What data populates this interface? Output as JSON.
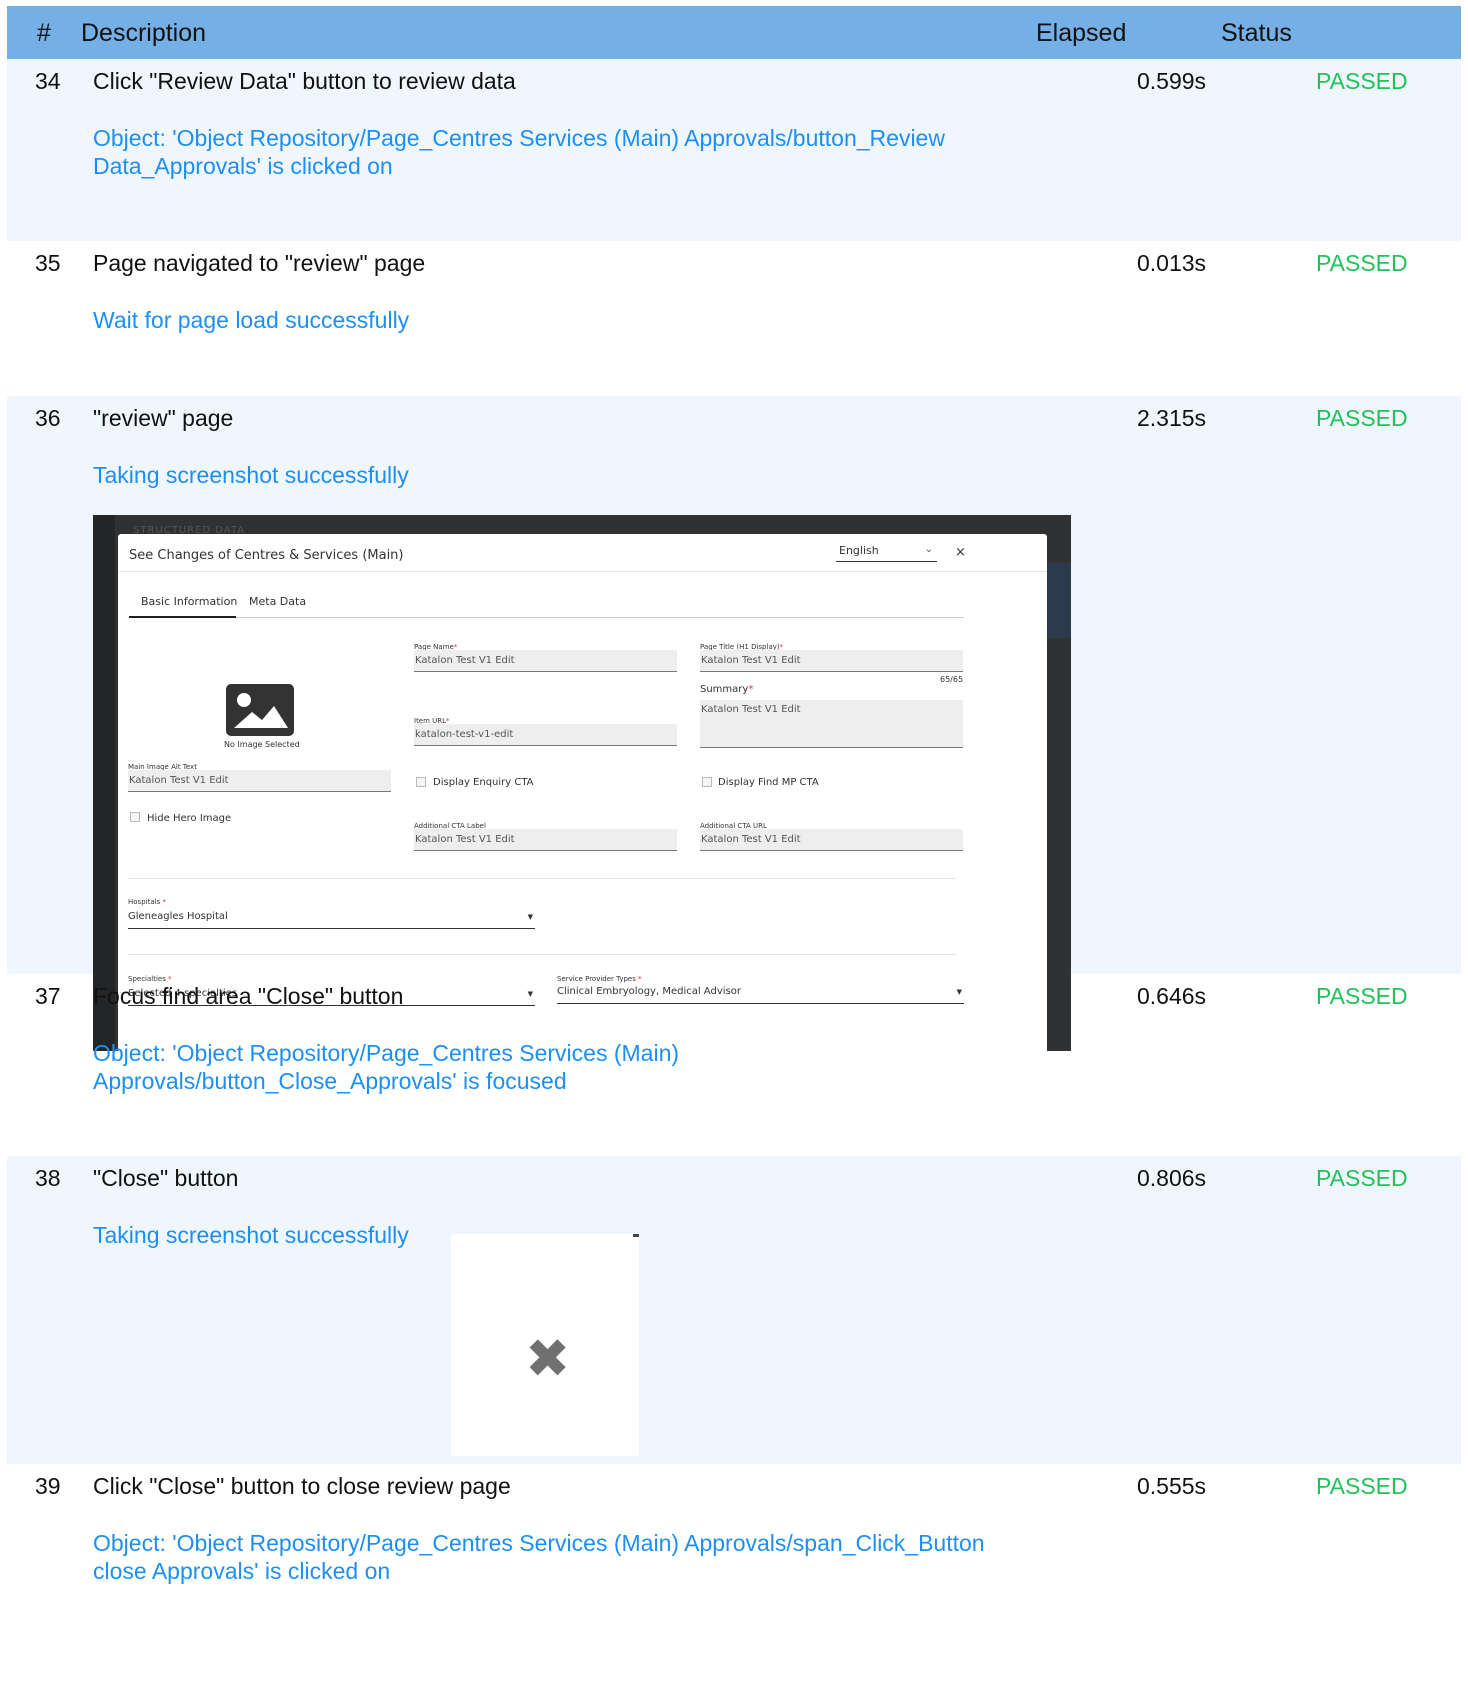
{
  "header": {
    "num": "#",
    "description": "Description",
    "elapsed": "Elapsed",
    "status": "Status"
  },
  "steps": [
    {
      "num": "34",
      "title": "Click \"Review Data\" button to review data",
      "elapsed": "0.599s",
      "status": "PASSED",
      "message_line1": "Object: 'Object Repository/Page_Centres  Services (Main) Approvals/button_Review",
      "message_line2": "Data_Approvals' is clicked on"
    },
    {
      "num": "35",
      "title": "Page navigated to \"review\" page",
      "elapsed": "0.013s",
      "status": "PASSED",
      "message_line1": "Wait for page load successfully"
    },
    {
      "num": "36",
      "title": "\"review\" page",
      "elapsed": "2.315s",
      "status": "PASSED",
      "message_line1": "Taking screenshot successfully"
    },
    {
      "num": "37",
      "title": "Focus find area \"Close\" button",
      "elapsed": "0.646s",
      "status": "PASSED",
      "message_line1": "Object: 'Object Repository/Page_Centres  Services (Main)",
      "message_line2": "Approvals/button_Close_Approvals' is focused"
    },
    {
      "num": "38",
      "title": "\"Close\" button",
      "elapsed": "0.806s",
      "status": "PASSED",
      "message_line1": "Taking screenshot successfully"
    },
    {
      "num": "39",
      "title": "Click \"Close\" button to close review page",
      "elapsed": "0.555s",
      "status": "PASSED",
      "message_line1": "Object: 'Object Repository/Page_Centres  Services (Main) Approvals/span_Click_Button",
      "message_line2": "close Approvals' is clicked on"
    }
  ],
  "screenshot": {
    "background_text": "STRUCTURED DATA",
    "modal_title": "See Changes of Centres & Services (Main)",
    "language": "English",
    "close_glyph": "×",
    "tabs": [
      "Basic Information",
      "Meta Data"
    ],
    "no_image_text": "No Image Selected",
    "fields": {
      "page_name_label": "Page Name",
      "page_name_value": "Katalon Test V1 Edit",
      "page_title_label": "Page Title (H1 Display)",
      "page_title_value": "Katalon Test V1 Edit",
      "page_title_count": "65/65",
      "summary_label": "Summary",
      "summary_value": "Katalon Test V1 Edit",
      "item_url_label": "Item URL",
      "item_url_value": "katalon-test-v1-edit",
      "main_image_alt_label": "Main Image Alt Text",
      "main_image_alt_value": "Katalon Test V1 Edit",
      "display_enquiry_cta": "Display Enquiry CTA",
      "display_find_mp_cta": "Display Find MP CTA",
      "hide_hero_image": "Hide Hero Image",
      "additional_cta_label_label": "Additional CTA Label",
      "additional_cta_label_value": "Katalon Test V1 Edit",
      "additional_cta_url_label": "Additional CTA URL",
      "additional_cta_url_value": "Katalon Test V1 Edit",
      "hospitals_label": "Hospitals",
      "hospitals_value": "Gleneagles Hospital",
      "specialties_label": "Specialties",
      "specialties_value": "Selected 4 specialties",
      "service_provider_types_label": "Service Provider Types",
      "service_provider_types_value": "Clinical Embryology, Medical Advisor",
      "required_mark": "*"
    }
  },
  "close_screenshot": {
    "glyph": "✖"
  },
  "colors": {
    "header_bg": "#74b0e6",
    "row_alt_bg": "#f0f6fd",
    "passed": "#21c25a",
    "message": "#1e8ff2"
  }
}
